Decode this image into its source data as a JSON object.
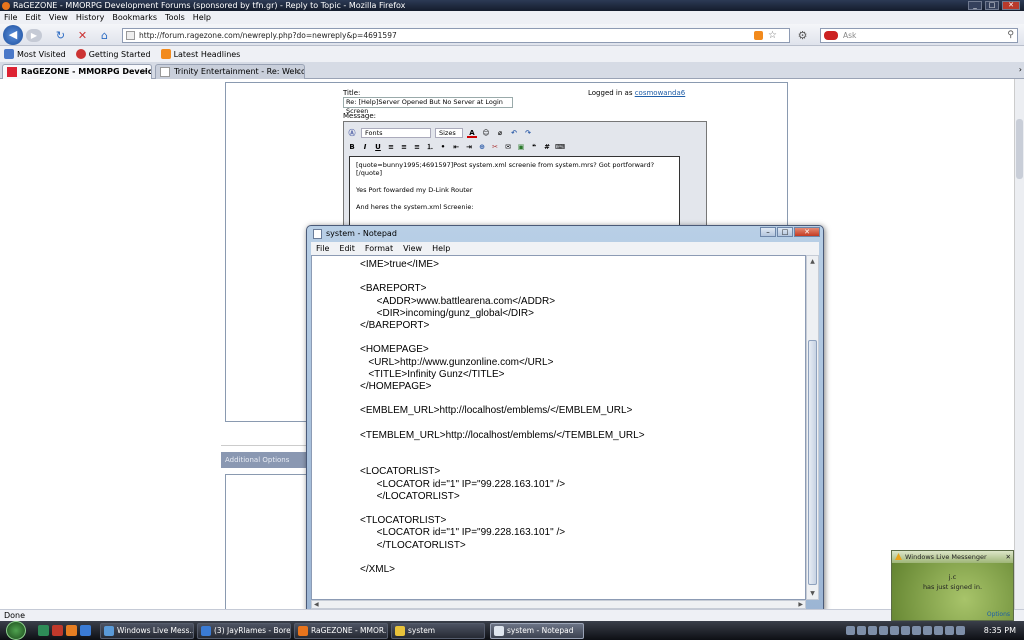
{
  "browser": {
    "title": "RaGEZONE - MMORPG Development Forums (sponsored by tfn.gr) - Reply to Topic - Mozilla Firefox",
    "menu": [
      "File",
      "Edit",
      "View",
      "History",
      "Bookmarks",
      "Tools",
      "Help"
    ],
    "url": "http://forum.ragezone.com/newreply.php?do=newreply&p=4691597",
    "search_placeholder": "Ask",
    "bookmarks": [
      "Most Visited",
      "Getting Started",
      "Latest Headlines"
    ],
    "tabs": [
      "RaGEZONE - MMORPG Developm...",
      "Trinity Entertainment - Re: Welcom..."
    ],
    "status": "Done"
  },
  "forum": {
    "title_label": "Title:",
    "title_value": "Re: [Help]Server Opened But No Server at Login Screen",
    "logged_in_prefix": "Logged in as",
    "username": "cosmowanda6",
    "message_label": "Message:",
    "font_dropdown": "Fonts",
    "size_dropdown": "Sizes",
    "editor_lines": [
      "[quote=bunny1995;4691597]Post system.xml screenie from system.mrs? Got portforward?[/quote]",
      "Yes Port fowarded my D-Link Router",
      "And heres the system.xml Screenie:"
    ],
    "additional_options": "Additional Options"
  },
  "notepad": {
    "title": "system - Notepad",
    "menu": [
      "File",
      "Edit",
      "Format",
      "View",
      "Help"
    ],
    "content": "<IME>true</IME>\n\n<BAREPORT>\n\t<ADDR>www.battlearena.com</ADDR>\n\t<DIR>incoming/gunz_global</DIR>\n</BAREPORT>\n\n<HOMEPAGE>\n   <URL>http://www.gunzonline.com</URL>\n   <TITLE>Infinity Gunz</TITLE>\n</HOMEPAGE>\n\n<EMBLEM_URL>http://localhost/emblems/</EMBLEM_URL>\n\n<TEMBLEM_URL>http://localhost/emblems/</TEMBLEM_URL>\n\n\n<LOCATORLIST>\n\t<LOCATOR id=\"1\" IP=\"99.228.163.101\" />\n\t</LOCATORLIST>\n\n<TLOCATORLIST>\n\t<LOCATOR id=\"1\" IP=\"99.228.163.101\" />\n\t</TLOCATORLIST>\n\n</XML>"
  },
  "taskbar": {
    "buttons": [
      "Windows Live Mess...",
      "(3) JayRlames - Bore...",
      "RaGEZONE - MMOR...",
      "system",
      "system - Notepad"
    ],
    "clock": "8:35 PM"
  },
  "toast": {
    "title": "Windows Live Messenger",
    "name": "j.c",
    "message": "has just signed in.",
    "options": "Options"
  }
}
